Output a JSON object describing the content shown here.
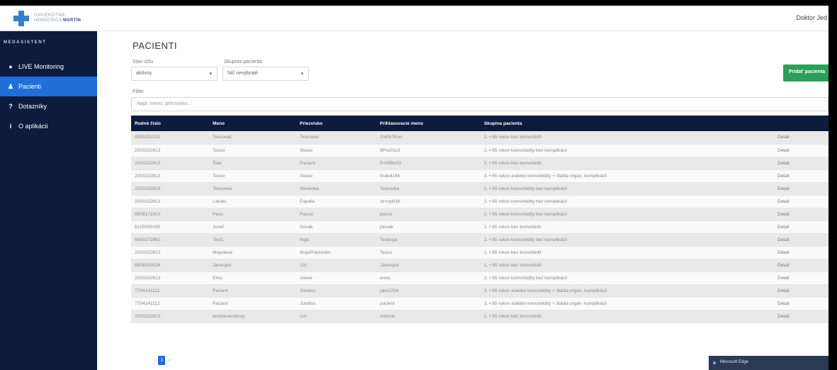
{
  "header": {
    "logo_line1": "UNIVERZITNÁ",
    "logo_line2": "NEMOCNICA",
    "logo_line3": "MARTIN",
    "user": "Doktor Jed"
  },
  "sidebar": {
    "brand": "MEDASISTENT",
    "items": [
      {
        "icon": "●",
        "label": "LIVE Monitoring"
      },
      {
        "icon": "♟",
        "label": "Pacienti"
      },
      {
        "icon": "?",
        "label": "Dotazníky"
      },
      {
        "icon": "i",
        "label": "O aplikácii"
      }
    ]
  },
  "main": {
    "title": "PACIENTI",
    "status_label": "Stav účtu",
    "status_value": "aktívny",
    "group_label": "Skupina pacienta",
    "group_value": "Nič nevybraté",
    "add_button": "Pridať pacienta",
    "filter_label": "Filter",
    "filter_placeholder": "Napr. meno, priezvisko..."
  },
  "table": {
    "columns": [
      "Rodné číslo",
      "Meno",
      "Priezvisko",
      "Prihlasovacie meno",
      "Skupina pacienta",
      ""
    ],
    "rows": [
      [
        "8305252232",
        "Tescovač",
        "Tescovač",
        "2m0h7Knn",
        "1. • 65 rokov bez komorbidít",
        "Detail"
      ],
      [
        "2003152813",
        "Tesco",
        "Skúse",
        "8Psc0113",
        "2. • 65 rokov komorbidity bez komplikácií",
        "Detail"
      ],
      [
        "2003152813",
        "Šiak",
        "Pacient",
        "Pz08BeGt",
        "1. • 65 rokov bez komorbidít",
        "Detail"
      ],
      [
        "2003152813",
        "Tesco",
        "Skúse",
        "lindo4166",
        "3. • 65 rokov a/alebo komorbidity + štádia orgán. komplikácií",
        "Detail"
      ],
      [
        "2203182818",
        "Tescovka",
        "Stevenka",
        "Tescovka",
        "2. • 65 rokov komorbidity bez komplikácií",
        "Detail"
      ],
      [
        "2003152813",
        "Lakato",
        "Papafa",
        "ztrcop81K",
        "2. • 65 rokov komorbidity bez komplikácií",
        "Detail"
      ],
      [
        "8808171910",
        "Peco",
        "Pacoo",
        "pecco",
        "2. • 65 rokov komorbidity bez komplikácií",
        "Detail"
      ],
      [
        "8105050165",
        "Jozef",
        "Novák",
        "jnovak",
        "1. • 65 rokov bez komorbidít",
        "Detail"
      ],
      [
        "8909272861",
        "Test1",
        "Inga",
        "Testinga",
        "2. • 65 rokov komorbidity bez komplikácií",
        "Detail"
      ],
      [
        "2003152813",
        "Mojeilena",
        "MojePriezvisko",
        "Tesco",
        "1. • 65 rokov bez komorbidít",
        "Detail"
      ],
      [
        "8808150534",
        "Janespot",
        "Uzi",
        "Janespot",
        "1. • 65 rokov bez komorbidít",
        "Detail"
      ],
      [
        "2003152813",
        "Elna",
        "Jonee",
        "eona",
        "2. • 65 rokov komorbidity bez komplikácií",
        "Detail"
      ],
      [
        "7704141112",
        "Pacient",
        "Jomitos",
        "jako2234",
        "3. • 65 rokov a/alebo komorbidity + štádia orgán. komplikácií",
        "Detail"
      ],
      [
        "7704141112",
        "Pacient",
        "Jomitos",
        "pacient",
        "3. • 65 rokov a/alebo komorbidity + štádia orgán. komplikácií",
        "Detail"
      ],
      [
        "2003152813",
        "testmenenikovy",
        "Uzi",
        "nnnnnn",
        "1. • 65 rokov bez komorbidít",
        "Detail"
      ]
    ]
  },
  "pager": {
    "prev": "‹",
    "current": "1",
    "next": "›"
  },
  "toast": {
    "text": "Microsoft Edge"
  }
}
